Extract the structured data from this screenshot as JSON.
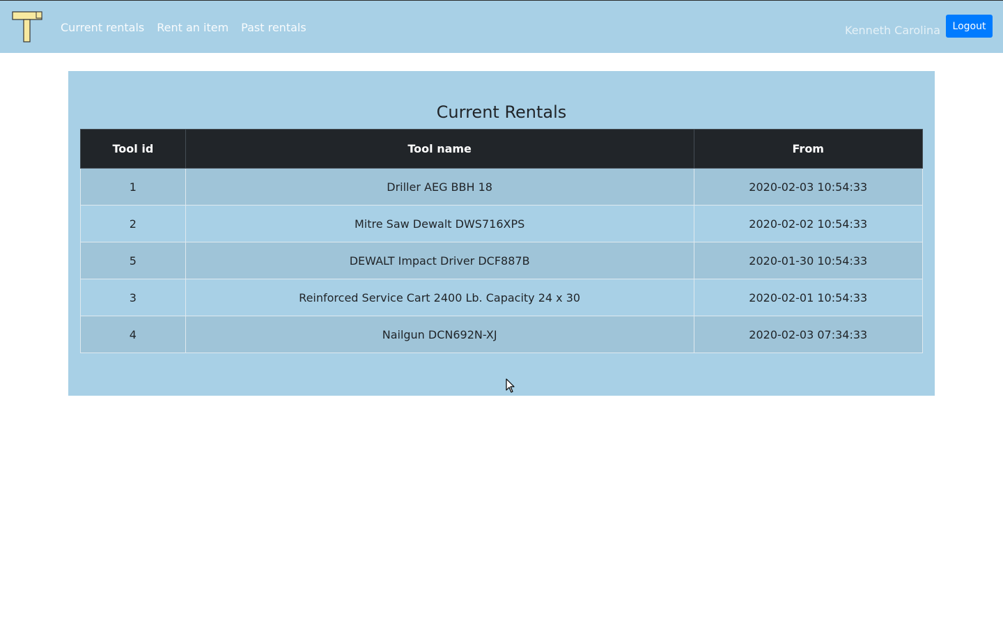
{
  "nav": {
    "links": [
      "Current rentals",
      "Rent an item",
      "Past rentals"
    ],
    "user_name": "Kenneth Carolina",
    "logout_label": "Logout",
    "logo_icon": "hammer-icon"
  },
  "main": {
    "title": "Current Rentals",
    "table": {
      "headers": [
        "Tool id",
        "Tool name",
        "From"
      ],
      "rows": [
        [
          "1",
          "Driller AEG BBH 18",
          "2020-02-03 10:54:33"
        ],
        [
          "2",
          "Mitre Saw Dewalt DWS716XPS",
          "2020-02-02 10:54:33"
        ],
        [
          "5",
          "DEWALT Impact Driver DCF887B",
          "2020-01-30 10:54:33"
        ],
        [
          "3",
          "Reinforced Service Cart 2400 Lb. Capacity 24 x 30",
          "2020-02-01 10:54:33"
        ],
        [
          "4",
          "Nailgun DCN692N-XJ",
          "2020-02-03 07:34:33"
        ]
      ]
    }
  },
  "colors": {
    "navbar_bg": "#a8d0e6",
    "panel_bg": "#a8d0e6",
    "header_bg": "#212529",
    "logout_bg": "#007bff"
  }
}
